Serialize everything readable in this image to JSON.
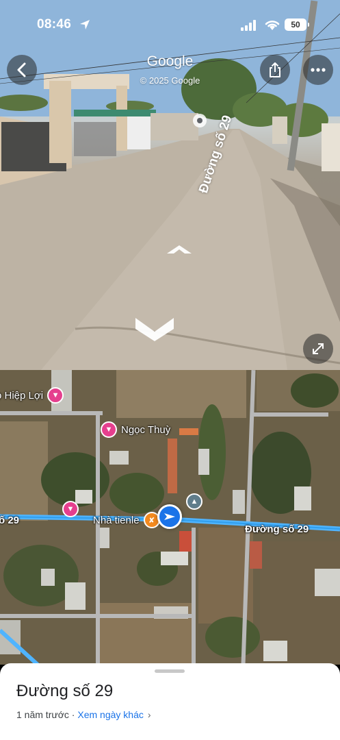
{
  "status_bar": {
    "time": "08:46",
    "battery": "50"
  },
  "street_view": {
    "title": "Google",
    "copyright": "© 2025 Google",
    "road_label": "Đường số 29",
    "icons": [
      "back-arrow-icon",
      "share-icon",
      "more-dots-icon",
      "expand-icon",
      "nav-chevron-icon"
    ]
  },
  "map": {
    "pois": [
      {
        "label": "ọ Hiệp Lợi"
      },
      {
        "label": "Ngọc Thuỳ"
      },
      {
        "label": ""
      },
      {
        "label": "Nhà tienle"
      }
    ],
    "road_labels": {
      "left": "ố 29",
      "right": "Đường số 29"
    },
    "colors": {
      "road_highlight": "#4fb4ff",
      "poi_lodging": "#e53f8e",
      "poi_food": "#f2891f",
      "location": "#1a73e8"
    }
  },
  "sheet": {
    "title": "Đường số 29",
    "time_ago": "1 năm trước",
    "separator": " · ",
    "other_dates_link": "Xem ngày khác",
    "chevron": "›"
  }
}
